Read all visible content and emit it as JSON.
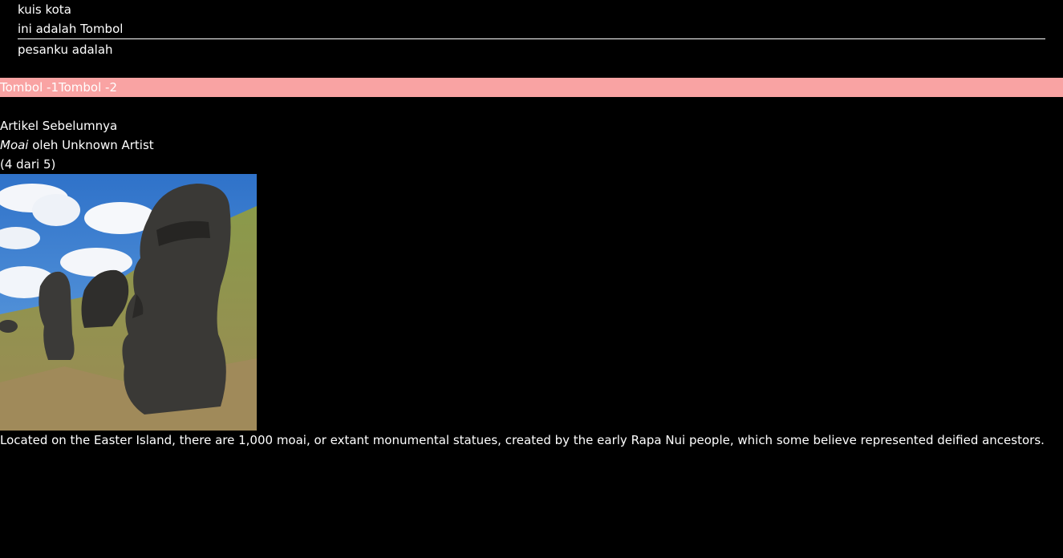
{
  "header": {
    "line1": "kuis kota",
    "line2": "ini adalah Tombol",
    "line3": "pesanku adalah"
  },
  "buttons": {
    "button1": "Tombol -1",
    "button2": "Tombol -2",
    "bar_color": "#f9a3a3"
  },
  "article": {
    "nav_label": "Artikel Sebelumnya",
    "title": "Moai",
    "by_artist": " oleh Unknown Artist",
    "position": "(4 dari 5)",
    "image_subject": "moai-statues-photo",
    "caption": "Located on the Easter Island, there are 1,000 moai, or extant monumental statues, created by the early Rapa Nui people, which some believe represented deified ancestors."
  }
}
